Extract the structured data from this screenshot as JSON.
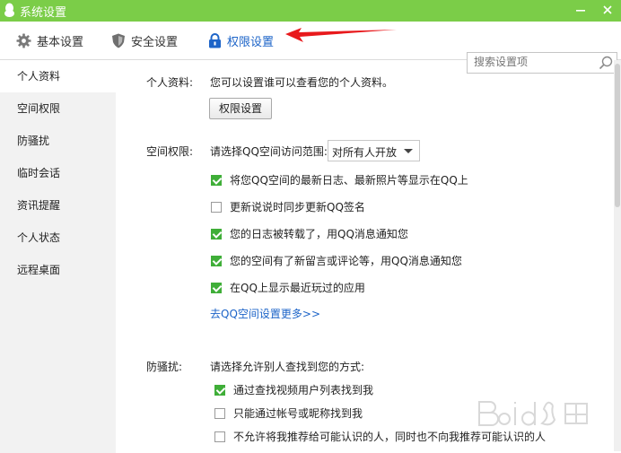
{
  "window": {
    "title": "系统设置"
  },
  "toolbar": {
    "tabs": [
      {
        "label": "基本设置",
        "icon": "gear-icon"
      },
      {
        "label": "安全设置",
        "icon": "shield-icon"
      },
      {
        "label": "权限设置",
        "icon": "lock-icon",
        "active": true
      }
    ],
    "search_placeholder": "搜索设置项"
  },
  "sidebar": {
    "items": [
      {
        "label": "个人资料",
        "selected": true
      },
      {
        "label": "空间权限"
      },
      {
        "label": "防骚扰"
      },
      {
        "label": "临时会话"
      },
      {
        "label": "资讯提醒"
      },
      {
        "label": "个人状态"
      },
      {
        "label": "远程桌面"
      }
    ]
  },
  "profile": {
    "label": "个人资料:",
    "description": "您可以设置谁可以查看您的个人资料。",
    "button": "权限设置"
  },
  "space": {
    "label": "空间权限:",
    "prompt": "请选择QQ空间访问范围:",
    "select_value": "对所有人开放",
    "options": [
      {
        "label": "将您QQ空间的最新日志、最新照片等显示在QQ上",
        "checked": true
      },
      {
        "label": "更新说说时同步更新QQ签名",
        "checked": false
      },
      {
        "label": "您的日志被转载了，用QQ消息通知您",
        "checked": true
      },
      {
        "label": "您的空间有了新留言或评论等，用QQ消息通知您",
        "checked": true
      },
      {
        "label": "在QQ上显示最近玩过的应用",
        "checked": true
      }
    ],
    "more_link": "去QQ空间设置更多>>"
  },
  "harass": {
    "label": "防骚扰:",
    "prompt": "请选择允许别人查找到您的方式:",
    "options": [
      {
        "label": "通过查找视频用户列表找到我",
        "checked": true
      },
      {
        "label": "只能通过帐号或昵称找到我",
        "checked": false
      },
      {
        "label": "不允许将我推荐给可能认识的人，同时也不向我推荐可能认识的人",
        "checked": false
      }
    ]
  },
  "colors": {
    "titlebar": "#7bcd48",
    "accent": "#1d64c8",
    "check": "#3fae38",
    "arrow": "#e8191c"
  }
}
